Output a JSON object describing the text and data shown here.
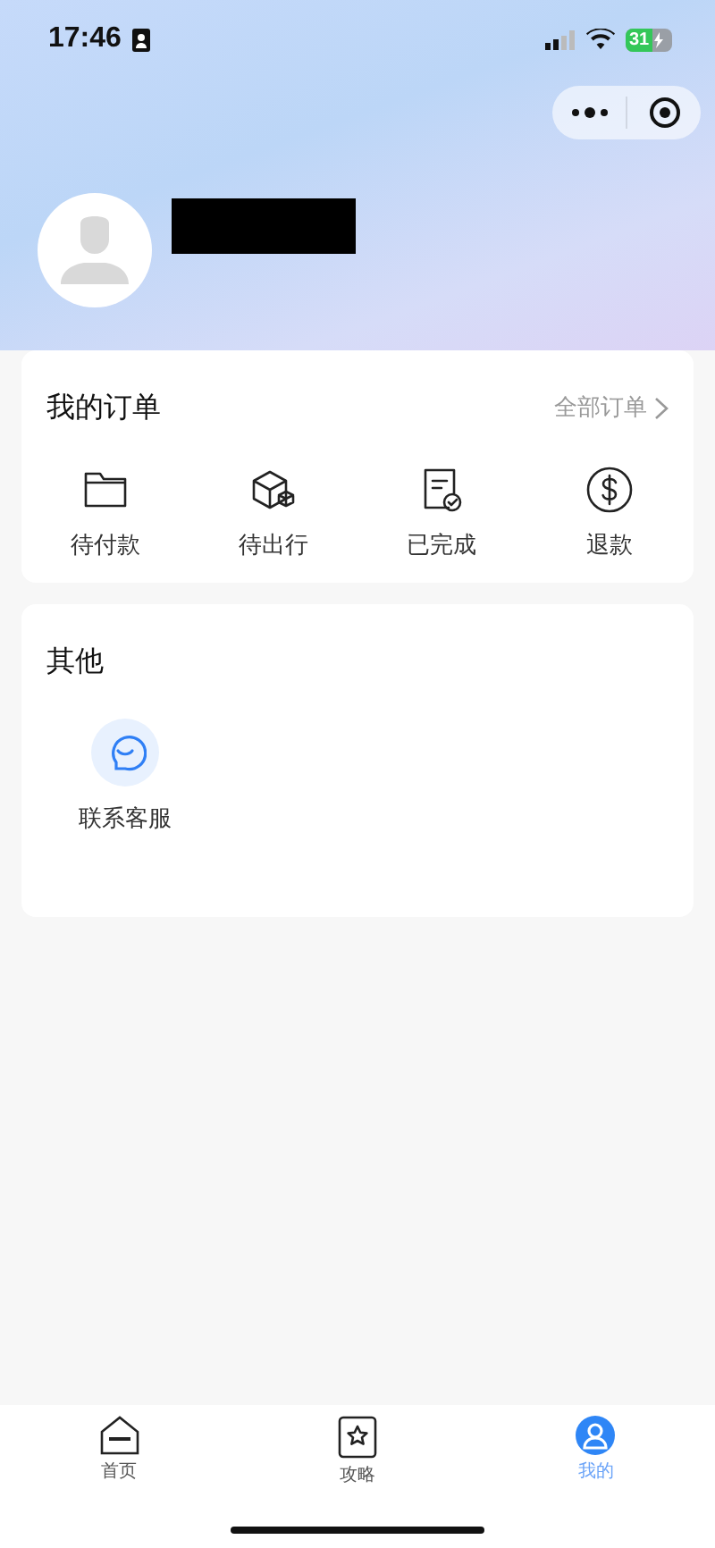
{
  "status_bar": {
    "time": "17:46",
    "battery": "31"
  },
  "profile": {
    "name_redacted": true
  },
  "orders": {
    "title": "我的订单",
    "all_link": "全部订单",
    "items": [
      {
        "kind": "folder",
        "label": "待付款"
      },
      {
        "kind": "box",
        "label": "待出行"
      },
      {
        "kind": "receipt",
        "label": "已完成"
      },
      {
        "kind": "dollar",
        "label": "退款"
      }
    ]
  },
  "other": {
    "title": "其他",
    "items": [
      {
        "kind": "chat",
        "label": "联系客服"
      }
    ]
  },
  "tab_bar": [
    {
      "kind": "home",
      "label": "首页",
      "selected": false
    },
    {
      "kind": "star",
      "label": "攻略",
      "selected": false
    },
    {
      "kind": "user",
      "label": "我的",
      "selected": true
    }
  ]
}
